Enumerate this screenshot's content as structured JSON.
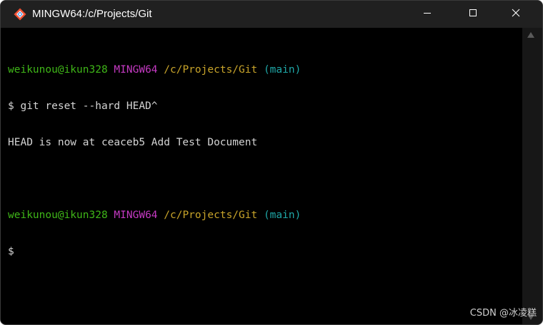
{
  "window": {
    "title": "MINGW64:/c/Projects/Git",
    "icon": "git-diamond-icon",
    "controls": [
      "minimize-icon",
      "maximize-icon",
      "close-icon"
    ]
  },
  "colors": {
    "user": "#3fb618",
    "env": "#c53ac3",
    "path": "#c8a42a",
    "branch": "#1fa7a7",
    "text": "#d4d4d4",
    "background": "#000000"
  },
  "terminal": {
    "lines": [
      {
        "user": "weikunou@ikun328",
        "env": "MINGW64",
        "path": "/c/Projects/Git",
        "branch": "(main)"
      },
      {
        "text": "$ git reset --hard HEAD^"
      },
      {
        "text": "HEAD is now at ceaceb5 Add Test Document"
      },
      {
        "text": ""
      },
      {
        "user": "weikunou@ikun328",
        "env": "MINGW64",
        "path": "/c/Projects/Git",
        "branch": "(main)"
      },
      {
        "text": "$"
      }
    ]
  },
  "watermark": "CSDN @冰凌糕"
}
